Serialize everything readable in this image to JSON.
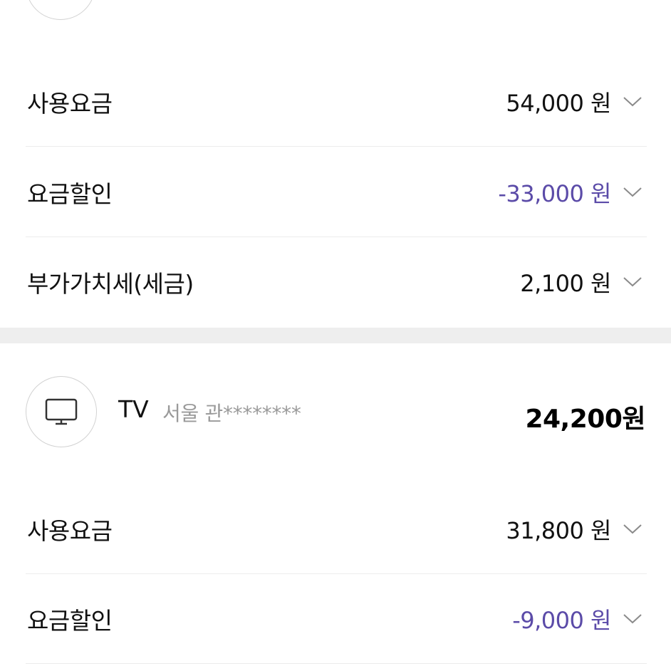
{
  "section_internet": {
    "rows": [
      {
        "label": "사용요금",
        "amount": "54,000 원",
        "negative": false
      },
      {
        "label": "요금할인",
        "amount": "-33,000 원",
        "negative": true
      },
      {
        "label": "부가가치세(세금)",
        "amount": "2,100 원",
        "negative": false
      }
    ]
  },
  "section_tv": {
    "service_name": "TV",
    "address": "서울 관********",
    "total": "24,200원",
    "icon": "tv-icon",
    "rows": [
      {
        "label": "사용요금",
        "amount": "31,800 원",
        "negative": false
      },
      {
        "label": "요금할인",
        "amount": "-9,000 원",
        "negative": true
      }
    ]
  },
  "colors": {
    "discount": "#5b4ba8",
    "divider": "#eeeeee",
    "address": "#9a9a9a"
  }
}
